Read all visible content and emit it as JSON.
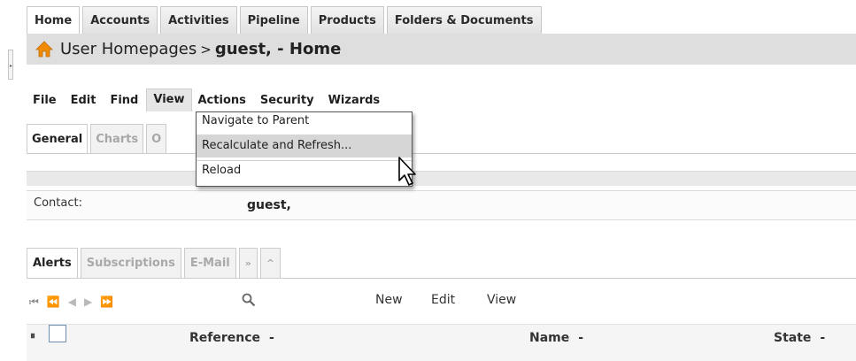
{
  "top_tabs": [
    "Home",
    "Accounts",
    "Activities",
    "Pipeline",
    "Products",
    "Folders & Documents"
  ],
  "breadcrumb": {
    "parent": "User Homepages",
    "separator": ">",
    "current": "guest, - Home"
  },
  "menu": [
    "File",
    "Edit",
    "Find",
    "View",
    "Actions",
    "Security",
    "Wizards"
  ],
  "view_menu": {
    "items": [
      "Navigate to Parent",
      "Recalculate and Refresh...",
      "Reload"
    ]
  },
  "sub_tabs": [
    "General",
    "Charts",
    "O"
  ],
  "contact": {
    "label": "Contact:",
    "value": "guest,"
  },
  "lower_tabs": [
    "Alerts",
    "Subscriptions",
    "E-Mail",
    "»",
    "^"
  ],
  "pager": [
    "⏮",
    "⏪",
    "◀",
    "▶",
    "⏩"
  ],
  "toolbar": {
    "new": "New",
    "edit": "Edit",
    "view": "View"
  },
  "columns": {
    "reference": "Reference",
    "name": "Name",
    "state": "State",
    "sort_marker": "-"
  },
  "colors": {
    "title_bar": "#dedede",
    "accent_orange": "#f08a00",
    "checkbox_border": "#6f8fb5"
  },
  "icons": {
    "home": "home-icon",
    "search": "search-icon",
    "pin": "pin-icon",
    "cursor": "mouse-pointer-icon"
  }
}
